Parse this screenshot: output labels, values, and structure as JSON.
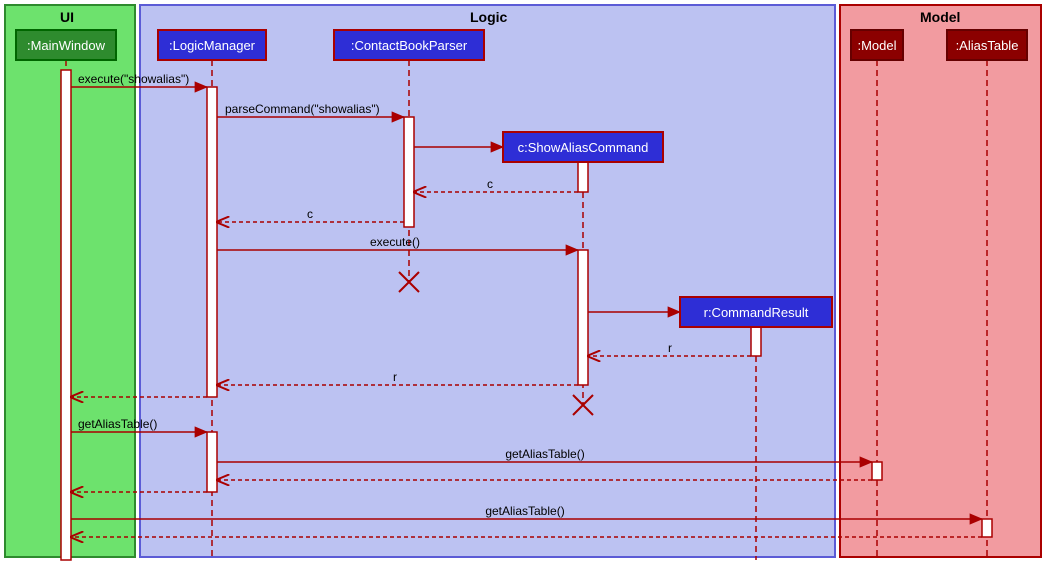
{
  "regions": {
    "ui": {
      "label": "UI"
    },
    "logic": {
      "label": "Logic"
    },
    "model": {
      "label": "Model"
    }
  },
  "participants": {
    "mainwindow": {
      "label": ":MainWindow"
    },
    "logicmanager": {
      "label": ":LogicManager"
    },
    "contactbookparser": {
      "label": ":ContactBookParser"
    },
    "showaliascommand": {
      "label": "c:ShowAliasCommand"
    },
    "commandresult": {
      "label": "r:CommandResult"
    },
    "model": {
      "label": ":Model"
    },
    "aliastable": {
      "label": ":AliasTable"
    }
  },
  "messages": {
    "m1": {
      "label": "execute(\"showalias\")"
    },
    "m2": {
      "label": "parseCommand(\"showalias\")"
    },
    "m3": {
      "label": "c"
    },
    "m4": {
      "label": "c"
    },
    "m5": {
      "label": "execute()"
    },
    "m6": {
      "label": "r"
    },
    "m7": {
      "label": "r"
    },
    "m8": {
      "label": "getAliasTable()"
    },
    "m9": {
      "label": "getAliasTable()"
    },
    "m10": {
      "label": "getAliasTable()"
    }
  },
  "chart_data": {
    "type": "sequence-diagram",
    "regions": [
      {
        "name": "UI",
        "participants": [
          "MainWindow"
        ]
      },
      {
        "name": "Logic",
        "participants": [
          "LogicManager",
          "ContactBookParser",
          "ShowAliasCommand",
          "CommandResult"
        ]
      },
      {
        "name": "Model",
        "participants": [
          "Model",
          "AliasTable"
        ]
      }
    ],
    "participants": [
      {
        "id": "MainWindow",
        "label": ":MainWindow"
      },
      {
        "id": "LogicManager",
        "label": ":LogicManager"
      },
      {
        "id": "ContactBookParser",
        "label": ":ContactBookParser"
      },
      {
        "id": "ShowAliasCommand",
        "label": "c:ShowAliasCommand",
        "created": true
      },
      {
        "id": "CommandResult",
        "label": "r:CommandResult",
        "created": true
      },
      {
        "id": "Model",
        "label": ":Model"
      },
      {
        "id": "AliasTable",
        "label": ":AliasTable"
      }
    ],
    "events": [
      {
        "type": "call",
        "from": "MainWindow",
        "to": "LogicManager",
        "label": "execute(\"showalias\")"
      },
      {
        "type": "call",
        "from": "LogicManager",
        "to": "ContactBookParser",
        "label": "parseCommand(\"showalias\")"
      },
      {
        "type": "create",
        "from": "ContactBookParser",
        "to": "ShowAliasCommand"
      },
      {
        "type": "return",
        "from": "ShowAliasCommand",
        "to": "ContactBookParser",
        "label": "c"
      },
      {
        "type": "return",
        "from": "ContactBookParser",
        "to": "LogicManager",
        "label": "c"
      },
      {
        "type": "call",
        "from": "LogicManager",
        "to": "ShowAliasCommand",
        "label": "execute()"
      },
      {
        "type": "destroy",
        "target": "ContactBookParser"
      },
      {
        "type": "create",
        "from": "ShowAliasCommand",
        "to": "CommandResult"
      },
      {
        "type": "return",
        "from": "CommandResult",
        "to": "ShowAliasCommand",
        "label": "r"
      },
      {
        "type": "return",
        "from": "ShowAliasCommand",
        "to": "LogicManager",
        "label": "r"
      },
      {
        "type": "return",
        "from": "LogicManager",
        "to": "MainWindow"
      },
      {
        "type": "destroy",
        "target": "ShowAliasCommand"
      },
      {
        "type": "call",
        "from": "MainWindow",
        "to": "LogicManager",
        "label": "getAliasTable()"
      },
      {
        "type": "call",
        "from": "LogicManager",
        "to": "Model",
        "label": "getAliasTable()"
      },
      {
        "type": "return",
        "from": "Model",
        "to": "LogicManager"
      },
      {
        "type": "return",
        "from": "LogicManager",
        "to": "MainWindow"
      },
      {
        "type": "call",
        "from": "MainWindow",
        "to": "AliasTable",
        "label": "getAliasTable()"
      },
      {
        "type": "return",
        "from": "AliasTable",
        "to": "MainWindow"
      }
    ]
  }
}
